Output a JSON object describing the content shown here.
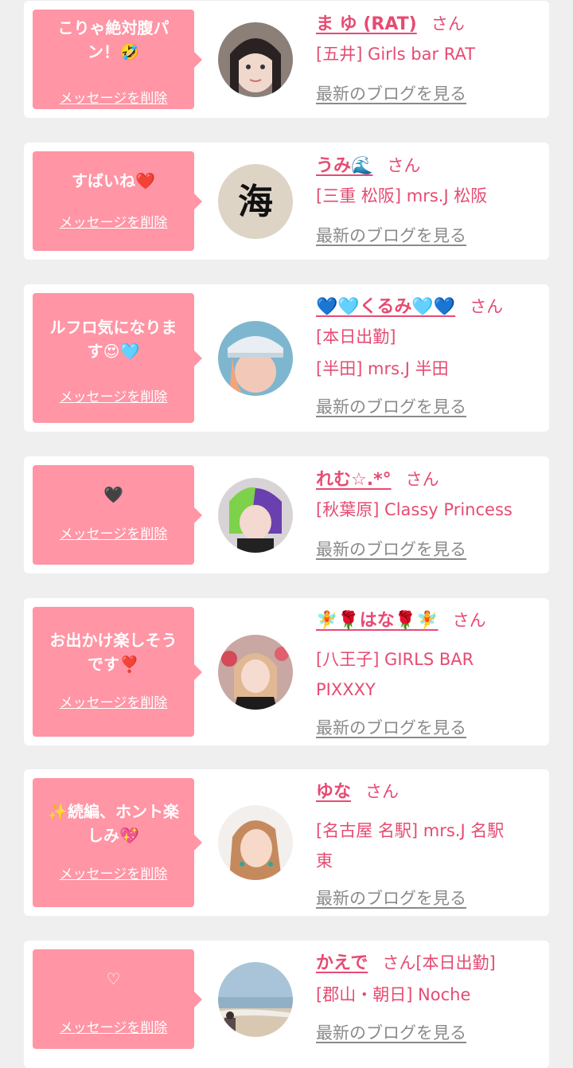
{
  "delete_label": "メッセージを削除",
  "san_label": "さん",
  "blog_label": "最新のブログを見る",
  "colors": {
    "accent": "#e64b72",
    "bubble": "#ff95a5",
    "muted": "#8a8a8a",
    "background": "#efefef"
  },
  "cards": [
    {
      "message": [
        "こりゃ絶対腹パ",
        "ン！🤣"
      ],
      "name": "ま ゆ (RAT)",
      "lines": [
        "[五井] Girls bar RAT"
      ],
      "avatar": "avatar-photo-icon"
    },
    {
      "message": [
        "すばいね❤️"
      ],
      "name": "うみ🌊",
      "lines": [
        "[三重 松阪] mrs.J 松阪"
      ],
      "avatar": "calligraphy-umi-icon"
    },
    {
      "message": [
        "ルフロ気になりま",
        "す😍🩵"
      ],
      "name": "💙🩵くるみ🩵💙",
      "lines": [
        "[本日出勤]",
        "[半田] mrs.J 半田"
      ],
      "avatar": "avatar-photo-icon"
    },
    {
      "message": [
        "🖤"
      ],
      "name": "れむ☆.*°",
      "lines": [
        "[秋葉原] Classy Princess"
      ],
      "avatar": "avatar-photo-icon"
    },
    {
      "message": [
        "お出かけ楽しそう",
        "です❣️"
      ],
      "name": "🧚🌹はな🌹🧚",
      "lines": [
        "[八王子] GIRLS BAR",
        "PIXXXY"
      ],
      "avatar": "avatar-photo-icon"
    },
    {
      "message": [
        "✨続編、ホント楽",
        "しみ💖"
      ],
      "name": "ゆな",
      "lines": [
        "[名古屋 名駅] mrs.J 名駅",
        "東"
      ],
      "avatar": "avatar-photo-icon"
    },
    {
      "message": [
        "♡"
      ],
      "name": "かえで",
      "san_suffix": "[本日出勤]",
      "lines": [
        "[郡山・朝日] Noche"
      ],
      "avatar": "avatar-beach-photo-icon"
    }
  ]
}
